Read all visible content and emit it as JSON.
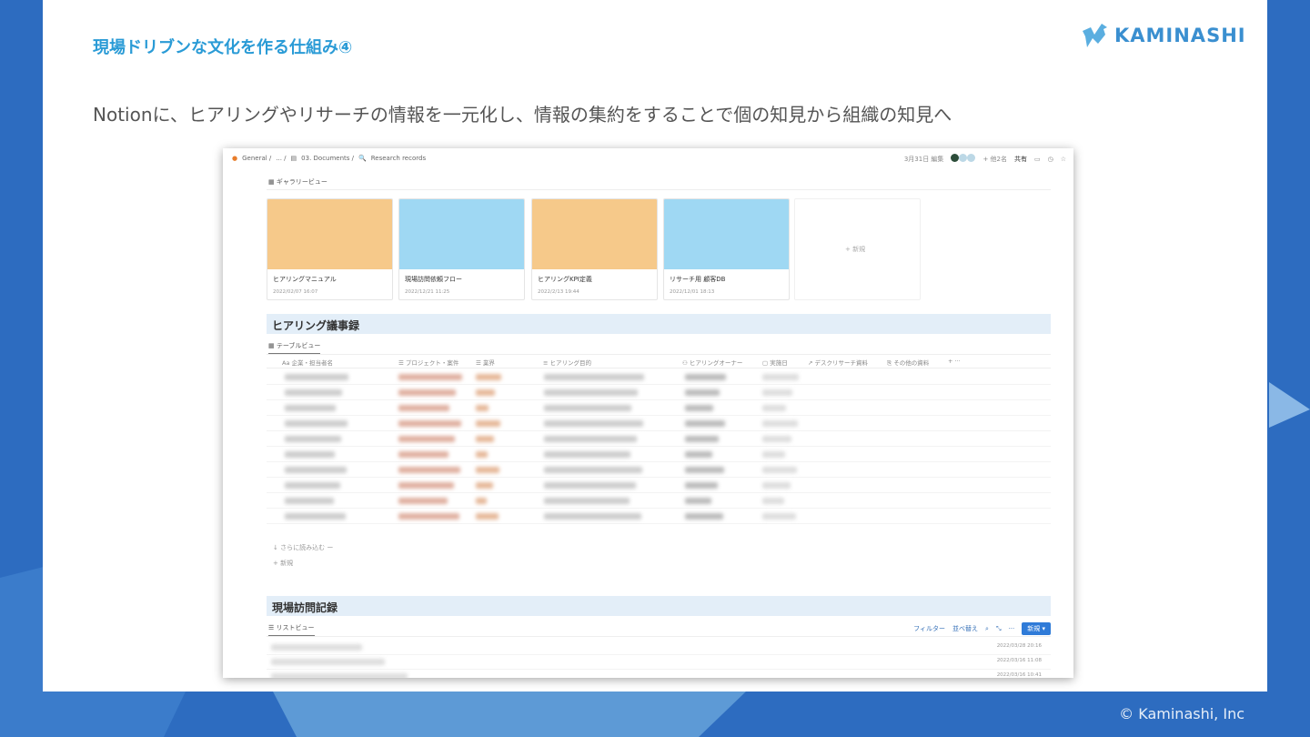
{
  "slide": {
    "title": "現場ドリブンな文化を作る仕組み④",
    "subtitle": "Notionに、ヒアリングやリサーチの情報を一元化し、情報の集約をすることで個の知見から組織の知見へ",
    "logo_text": "KAMINASHI",
    "footer": "© Kaminashi, Inc",
    "accent": "#2a9bd6",
    "background": "#2d6cc0"
  },
  "notion": {
    "breadcrumb": [
      "General /",
      "... /",
      "03. Documents /",
      "Research records"
    ],
    "topbar": {
      "edited": "3月31日 編集",
      "more_users": "+ 他2名",
      "share": "共有"
    },
    "gallery": {
      "tab": "ギャラリービュー",
      "cards": [
        {
          "name": "ヒアリングマニュアル",
          "date": "2022/02/07 16:07",
          "bg": "#f6c98a"
        },
        {
          "name": "現場訪問依頼フロー",
          "date": "2022/12/21 11:25",
          "bg": "#9fd8f3"
        },
        {
          "name": "ヒアリングKPI定義",
          "date": "2022/2/13 19:44",
          "bg": "#f6c98a"
        },
        {
          "name": "リサーチ用 顧客DB",
          "date": "2022/12/01 18:13",
          "bg": "#9fd8f3"
        }
      ],
      "new_label": "+ 新規"
    },
    "hearing": {
      "heading": "ヒアリング議事録",
      "tab": "テーブルビュー",
      "columns": [
        "Aa 企業・担当者名",
        "☰ プロジェクト・案件",
        "☰ 業界",
        "≡ ヒアリング目的",
        "⚇ ヒアリングオーナー",
        "▢ 実施日",
        "↗ デスクリサーチ資料",
        "⎘ その他の資料",
        "+ ···"
      ],
      "load_more": "↓ さらに読み込む ー",
      "new_label": "+ 新規"
    },
    "visit": {
      "heading": "現場訪問記録",
      "tab": "リストビュー",
      "filter": "フィルター",
      "sort": "並べ替え",
      "new_button": "新規",
      "dates": [
        "2022/03/28 20:16",
        "2022/03/16 11:08",
        "2022/03/16 10:41"
      ]
    }
  }
}
